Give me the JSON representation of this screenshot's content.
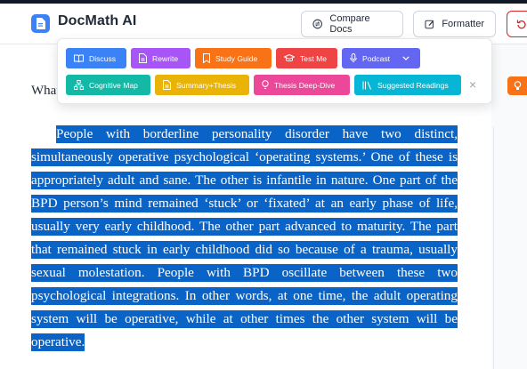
{
  "app": {
    "title": "DocMath AI"
  },
  "header": {
    "compare_label": "Compare Docs",
    "formatter_label": "Formatter"
  },
  "document": {
    "heading_partial": "What",
    "paragraph": "People with borderline personality disorder have two distinct, simultaneously operative psychological ‘operating systems.’ One of these is appropriately adult and sane. The other is infantile in nature. One part of the BPD person’s mind remained ‘stuck’ or ‘fixated’ at an early phase of life, usually very early childhood. The other part advanced to maturity. The part that remained stuck in early childhood did so because of a trauma, usually sexual molestation. People with BPD oscillate between these two psychological integrations. In other words, at one time, the adult operating system will be operative, while at other times the other system will be operative."
  },
  "actions": {
    "row1": [
      {
        "label": "Discuss",
        "color": "#3b82f6",
        "icon": "book-icon"
      },
      {
        "label": "Rewrite",
        "color": "#a855f7",
        "icon": "document-icon"
      },
      {
        "label": "Study Guide",
        "color": "#f97316",
        "icon": "bookmark-icon"
      },
      {
        "label": "Test Me",
        "color": "#ef4444",
        "icon": "graduation-cap-icon"
      },
      {
        "label": "Podcast",
        "color": "#6366f1",
        "icon": "microphone-icon"
      }
    ],
    "row2": [
      {
        "label": "Cognitive Map",
        "color": "#14b8a6",
        "icon": "network-icon"
      },
      {
        "label": "Summary+Thesis",
        "color": "#eab308",
        "icon": "document-icon"
      },
      {
        "label": "Thesis Deep-Dive",
        "color": "#ec4899",
        "icon": "lightbulb-icon"
      },
      {
        "label": "Suggested Readings",
        "color": "#06b6d4",
        "icon": "library-icon"
      }
    ],
    "close_label": "×"
  },
  "colors": {
    "selection": "#0a64c8",
    "brand": "#3b82f6",
    "danger_outline": "#dc2626",
    "right_panel_button": "#f97316"
  }
}
